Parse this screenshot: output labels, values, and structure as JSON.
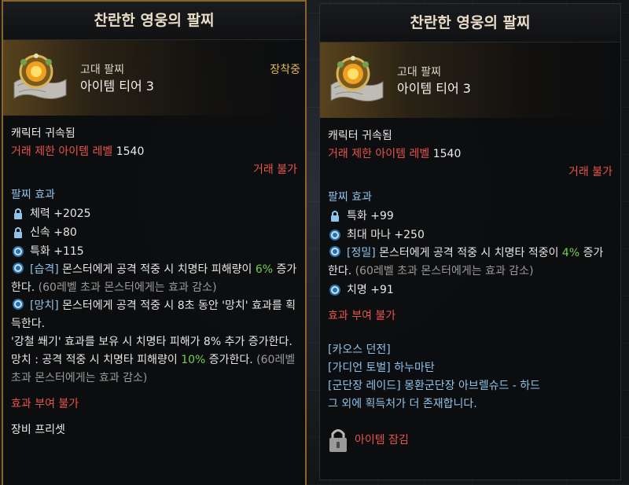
{
  "left": {
    "title": "찬란한 영웅의 팔찌",
    "item_type": "고대 팔찌",
    "tier": "아이템 티어 3",
    "equipped_label": "장착중",
    "bound": "캐릭터 귀속됨",
    "trade_req_label": "거래 제한 아이템 레벨",
    "trade_req_level": "1540",
    "trade_status": "거래 불가",
    "effect_section": "팔찌 효과",
    "stats": [
      {
        "icon": "lock-icon",
        "text": "체력 +2025"
      },
      {
        "icon": "lock-icon",
        "text": "신속 +80"
      },
      {
        "icon": "swirl-icon",
        "text": "특화 +115"
      }
    ],
    "effect1": {
      "tag": "[습격]",
      "text_a": " 몬스터에게 공격 적중 시 치명타 피해량이 ",
      "value": "6%",
      "text_b": " 증가한다.",
      "note": " (60레벨 초과 몬스터에게는 효과 감소)"
    },
    "effect2": {
      "tag": "[망치]",
      "text": " 몬스터에게 공격 적중 시 8초 동안 '망치' 효과를 획득한다."
    },
    "effect2_line2": "'강철 쐐기' 효과를 보유 시 치명타 피해가 8% 추가 증가한다.",
    "effect2_line3_a": "망치 : 공격 적중 시 치명타 피해량이 ",
    "effect2_line3_value": "10%",
    "effect2_line3_b": " 증가한다.",
    "effect2_line3_note": " (60레벨 초과 몬스터에게는 효과 감소)",
    "no_enchant": "효과 부여 불가",
    "preset": "장비 프리셋"
  },
  "right": {
    "title": "찬란한 영웅의 팔찌",
    "item_type": "고대 팔찌",
    "tier": "아이템 티어 3",
    "bound": "캐릭터 귀속됨",
    "trade_req_label": "거래 제한 아이템 레벨",
    "trade_req_level": "1540",
    "trade_status": "거래 불가",
    "effect_section": "팔찌 효과",
    "stats": [
      {
        "icon": "lock-icon",
        "text": "특화 +99"
      },
      {
        "icon": "swirl-icon",
        "text": "최대 마나 +250"
      }
    ],
    "effect1": {
      "tag": "[정밀]",
      "text_a": " 몬스터에게 공격 적중 시 치명타 적중이 ",
      "value": "4%",
      "text_b": " 증가한다.",
      "note": " (60레벨 초과 몬스터에게는 효과 감소)"
    },
    "stat_extra": "치명 +91",
    "no_enchant": "효과 부여 불가",
    "sources": [
      "[카오스 던전]",
      "[가디언 토벌] 하누마탄",
      "[군단장 레이드] 몽환군단장 아브렐슈드 - 하드",
      "그 외에 획득처가 더 존재합니다."
    ],
    "locked_label": "아이템 잠김"
  },
  "colors": {
    "border_gold": "#8a6428",
    "red": "#e8544a",
    "blue": "#8fc4ea",
    "green": "#6fd24a",
    "gold": "#e0b85a"
  }
}
